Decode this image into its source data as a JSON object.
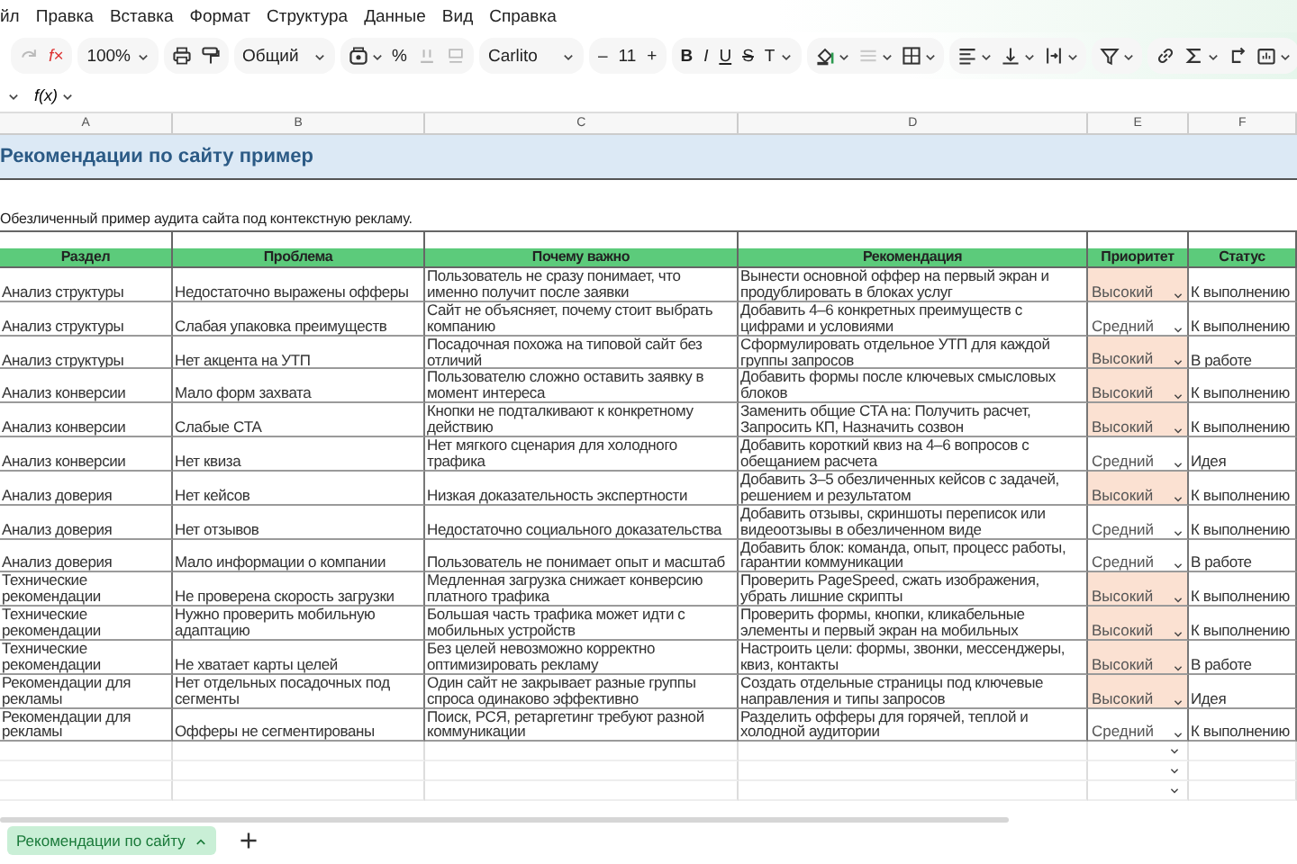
{
  "menu": [
    "йл",
    "Правка",
    "Вставка",
    "Формат",
    "Структура",
    "Данные",
    "Вид",
    "Справка"
  ],
  "toolbar": {
    "formula": "f×",
    "zoom": "100%",
    "number_format": "Общий",
    "percent": "%",
    "font": "Carlito",
    "size_down": "–",
    "font_size": "11",
    "size_up": "+",
    "bold": "B",
    "italic": "I",
    "underline": "U",
    "strike": "S",
    "text_style": "T"
  },
  "formula_bar": {
    "function_label": "f(x)"
  },
  "columns": [
    "A",
    "B",
    "C",
    "D",
    "E",
    "F"
  ],
  "title": "Рекомендации по сайту пример",
  "subtitle": "Обезличенный пример аудита сайта под контекстную рекламу.",
  "headers": [
    "Раздел",
    "Проблема",
    "Почему важно",
    "Рекомендация",
    "Приоритет",
    "Статус"
  ],
  "rows": [
    {
      "section": "Анализ структуры",
      "problem": "Недостаточно выражены офферы",
      "reason": "Пользователь не сразу понимает, что именно получит после заявки",
      "recommendation": "Вынести основной оффер на первый экран и продублировать в блоках услуг",
      "priority": "Высокий",
      "priority_highlighted": true,
      "status": "К выполнению"
    },
    {
      "section": "Анализ структуры",
      "problem": "Слабая упаковка преимуществ",
      "reason": "Сайт не объясняет, почему стоит выбрать компанию",
      "recommendation": "Добавить 4–6 конкретных преимуществ с цифрами и условиями",
      "priority": "Средний",
      "priority_highlighted": false,
      "status": "К выполнению"
    },
    {
      "section": "Анализ структуры",
      "problem": "Нет акцента на УТП",
      "reason": "Посадочная похожа на типовой сайт без отличий",
      "recommendation": "Сформулировать отдельное УТП для каждой группы запросов",
      "priority": "Высокий",
      "priority_highlighted": true,
      "status": "В работе"
    },
    {
      "section": "Анализ конверсии",
      "problem": "Мало форм захвата",
      "reason": "Пользователю сложно оставить заявку в момент интереса",
      "recommendation": "Добавить формы после ключевых смысловых блоков",
      "priority": "Высокий",
      "priority_highlighted": true,
      "status": "К выполнению"
    },
    {
      "section": "Анализ конверсии",
      "problem": "Слабые CTA",
      "reason": "Кнопки не подталкивают к конкретному действию",
      "recommendation": "Заменить общие CTA на: Получить расчет, Запросить КП, Назначить созвон",
      "priority": "Высокий",
      "priority_highlighted": true,
      "status": "К выполнению"
    },
    {
      "section": "Анализ конверсии",
      "problem": "Нет квиза",
      "reason": "Нет мягкого сценария для холодного трафика",
      "recommendation": "Добавить короткий квиз на 4–6 вопросов с обещанием расчета",
      "priority": "Средний",
      "priority_highlighted": false,
      "status": "Идея"
    },
    {
      "section": "Анализ доверия",
      "problem": "Нет кейсов",
      "reason": "Низкая доказательность экспертности",
      "recommendation": "Добавить 3–5 обезличенных кейсов с задачей, решением и результатом",
      "priority": "Высокий",
      "priority_highlighted": true,
      "status": "К выполнению"
    },
    {
      "section": "Анализ доверия",
      "problem": "Нет отзывов",
      "reason": "Недостаточно социального доказательства",
      "recommendation": "Добавить отзывы, скриншоты переписок или видеоотзывы в обезличенном виде",
      "priority": "Средний",
      "priority_highlighted": false,
      "status": "К выполнению"
    },
    {
      "section": "Анализ доверия",
      "problem": "Мало информации о компании",
      "reason": "Пользователь не понимает опыт и масштаб",
      "recommendation": "Добавить блок: команда, опыт, процесс работы, гарантии коммуникации",
      "priority": "Средний",
      "priority_highlighted": false,
      "status": "В работе"
    },
    {
      "section": "Технические рекомендации",
      "problem": "Не проверена скорость загрузки",
      "reason": "Медленная загрузка снижает конверсию платного трафика",
      "recommendation": "Проверить PageSpeed, сжать изображения, убрать лишние скрипты",
      "priority": "Высокий",
      "priority_highlighted": true,
      "status": "К выполнению"
    },
    {
      "section": "Технические рекомендации",
      "problem": "Нужно проверить мобильную адаптацию",
      "reason": "Большая часть трафика может идти с мобильных устройств",
      "recommendation": "Проверить формы, кнопки, кликабельные элементы и первый экран на мобильных",
      "priority": "Высокий",
      "priority_highlighted": true,
      "status": "К выполнению"
    },
    {
      "section": "Технические рекомендации",
      "problem": "Не хватает карты целей",
      "reason": "Без целей невозможно корректно оптимизировать рекламу",
      "recommendation": "Настроить цели: формы, звонки, мессенджеры, квиз, контакты",
      "priority": "Высокий",
      "priority_highlighted": true,
      "status": "В работе"
    },
    {
      "section": "Рекомендации для рекламы",
      "problem": "Нет отдельных посадочных под сегменты",
      "reason": "Один сайт не закрывает разные группы спроса одинаково эффективно",
      "recommendation": "Создать отдельные страницы под ключевые направления и типы запросов",
      "priority": "Высокий",
      "priority_highlighted": true,
      "status": "Идея"
    },
    {
      "section": "Рекомендации для рекламы",
      "problem": "Офферы не сегментированы",
      "reason": "Поиск, РСЯ, ретаргетинг требуют разной коммуникации",
      "recommendation": "Разделить офферы для горячей, теплой и холодной аудитории",
      "priority": "Средний",
      "priority_highlighted": false,
      "status": "К выполнению"
    }
  ],
  "sheet_tabs": [
    {
      "label": "Рекомендации по сайту",
      "selected": true
    }
  ]
}
